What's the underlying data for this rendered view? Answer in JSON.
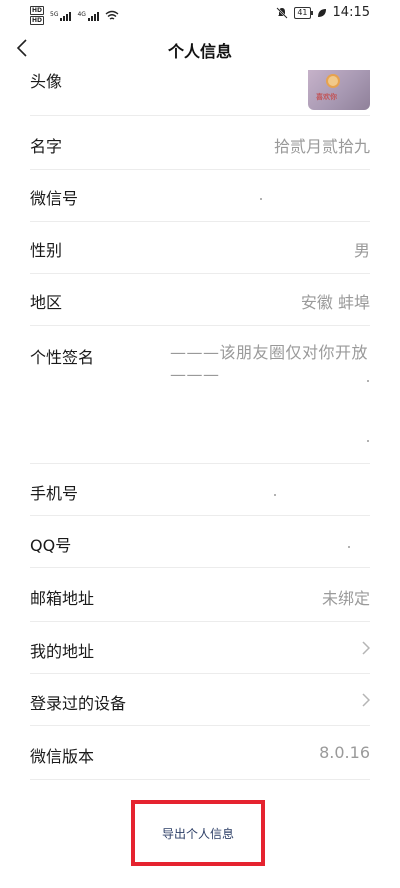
{
  "status_bar": {
    "time": "14:15",
    "battery": "41",
    "network_1": "5G",
    "network_2": "4G"
  },
  "nav": {
    "title": "个人信息"
  },
  "rows": {
    "avatar": {
      "label": "头像",
      "avatar_text": "喜欢你"
    },
    "name": {
      "label": "名字",
      "value": "拾贰月贰拾九"
    },
    "wechat_id": {
      "label": "微信号",
      "value": ""
    },
    "gender": {
      "label": "性别",
      "value": "男"
    },
    "region": {
      "label": "地区",
      "value": "安徽 蚌埠"
    },
    "signature": {
      "label": "个性签名",
      "value": "———该朋友圈仅对你开放———"
    },
    "phone": {
      "label": "手机号",
      "value": ""
    },
    "qq": {
      "label": "QQ号",
      "value": ""
    },
    "email": {
      "label": "邮箱地址",
      "value": "未绑定"
    },
    "my_address": {
      "label": "我的地址"
    },
    "devices": {
      "label": "登录过的设备"
    },
    "version": {
      "label": "微信版本",
      "value": "8.0.16"
    }
  },
  "export": {
    "label": "导出个人信息"
  },
  "colors": {
    "highlight_border": "#e5232f",
    "export_text": "#2c3e66"
  }
}
